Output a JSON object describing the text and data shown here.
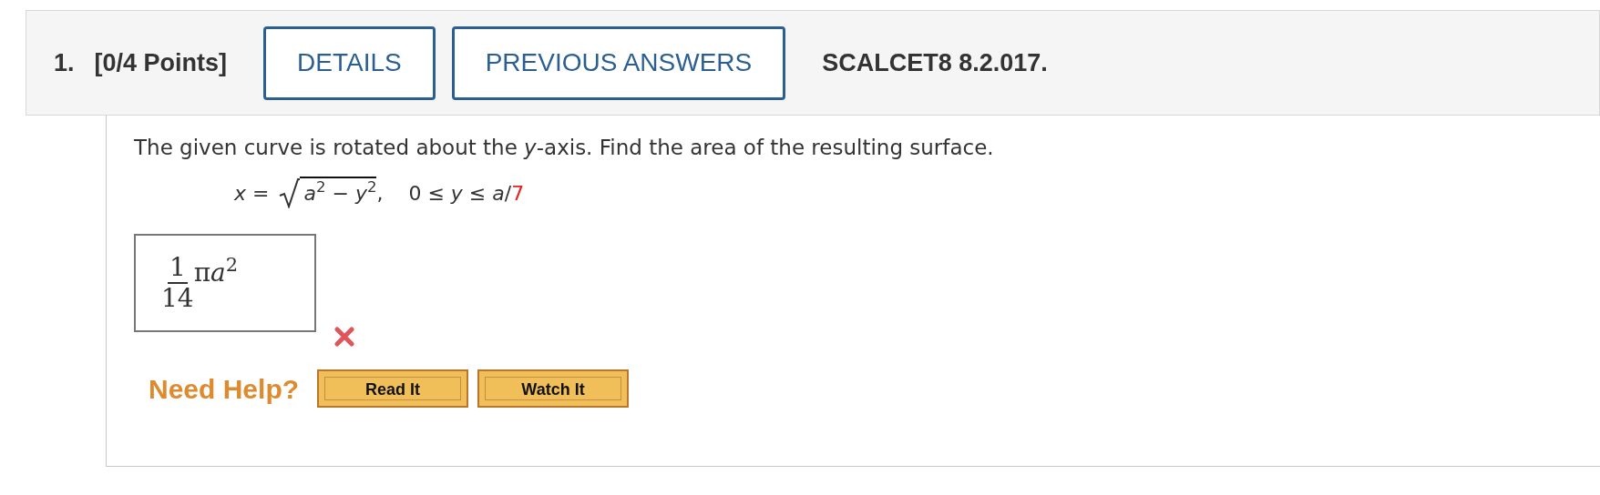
{
  "question": {
    "number": "1.",
    "points": "[0/4 Points]",
    "buttons": [
      {
        "label": "DETAILS"
      },
      {
        "label": "PREVIOUS ANSWERS"
      }
    ],
    "source": "SCALCET8 8.2.017."
  },
  "prompt": "The given curve is rotated about the *y*-axis. Find the area of the resulting surface.",
  "formula": {
    "lhs": "*x* =",
    "radicand": "*a*$^{2}$ − *y*$^{2}$",
    "separator": ",",
    "range": "0 ≤ *y* ≤ *a*/",
    "highlight": "7"
  },
  "answer": {
    "numerator": "1",
    "denominator": "14",
    "symbol": "π",
    "rest": "*a*$^{2}$",
    "correct": false
  },
  "help": {
    "label": "Need Help?",
    "buttons": [
      {
        "label": "Read It"
      },
      {
        "label": "Watch It"
      }
    ]
  }
}
